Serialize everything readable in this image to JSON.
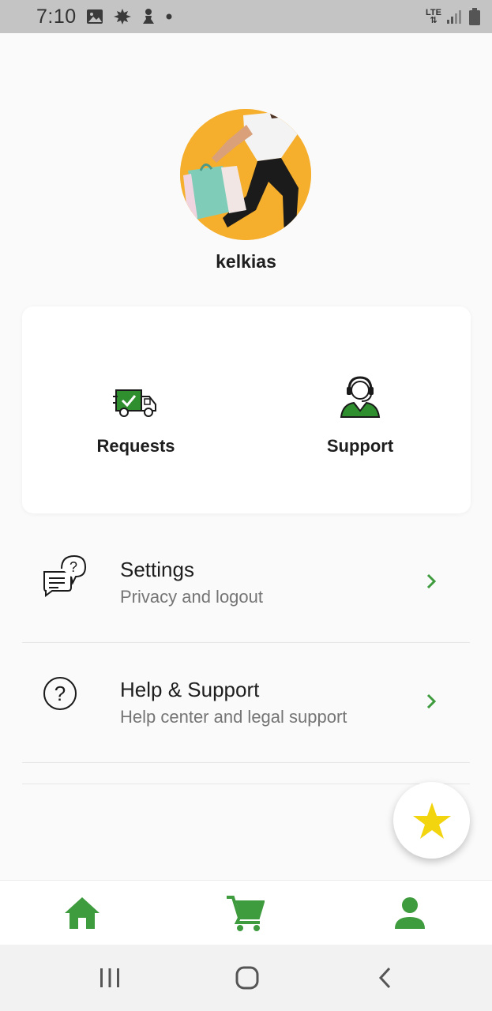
{
  "status_bar": {
    "time": "7:10",
    "network": "LTE",
    "icons": [
      "image-icon",
      "leaf-icon",
      "chess-pawn-icon",
      "dot-icon",
      "lte-icon",
      "signal-icon",
      "battery-icon"
    ]
  },
  "profile": {
    "username": "kelkias"
  },
  "actions": {
    "requests_label": "Requests",
    "support_label": "Support"
  },
  "menu": {
    "items": [
      {
        "title": "Settings",
        "subtitle": "Privacy and logout",
        "icon": "chat-question-icon"
      },
      {
        "title": "Help & Support",
        "subtitle": "Help center and legal support",
        "icon": "help-circle-icon"
      }
    ]
  },
  "bottom_nav": {
    "items": [
      "home-icon",
      "cart-icon",
      "profile-icon"
    ]
  },
  "colors": {
    "accent": "#3e9b3e",
    "star": "#f2d40f",
    "avatar_bg": "#f6ae2d"
  }
}
